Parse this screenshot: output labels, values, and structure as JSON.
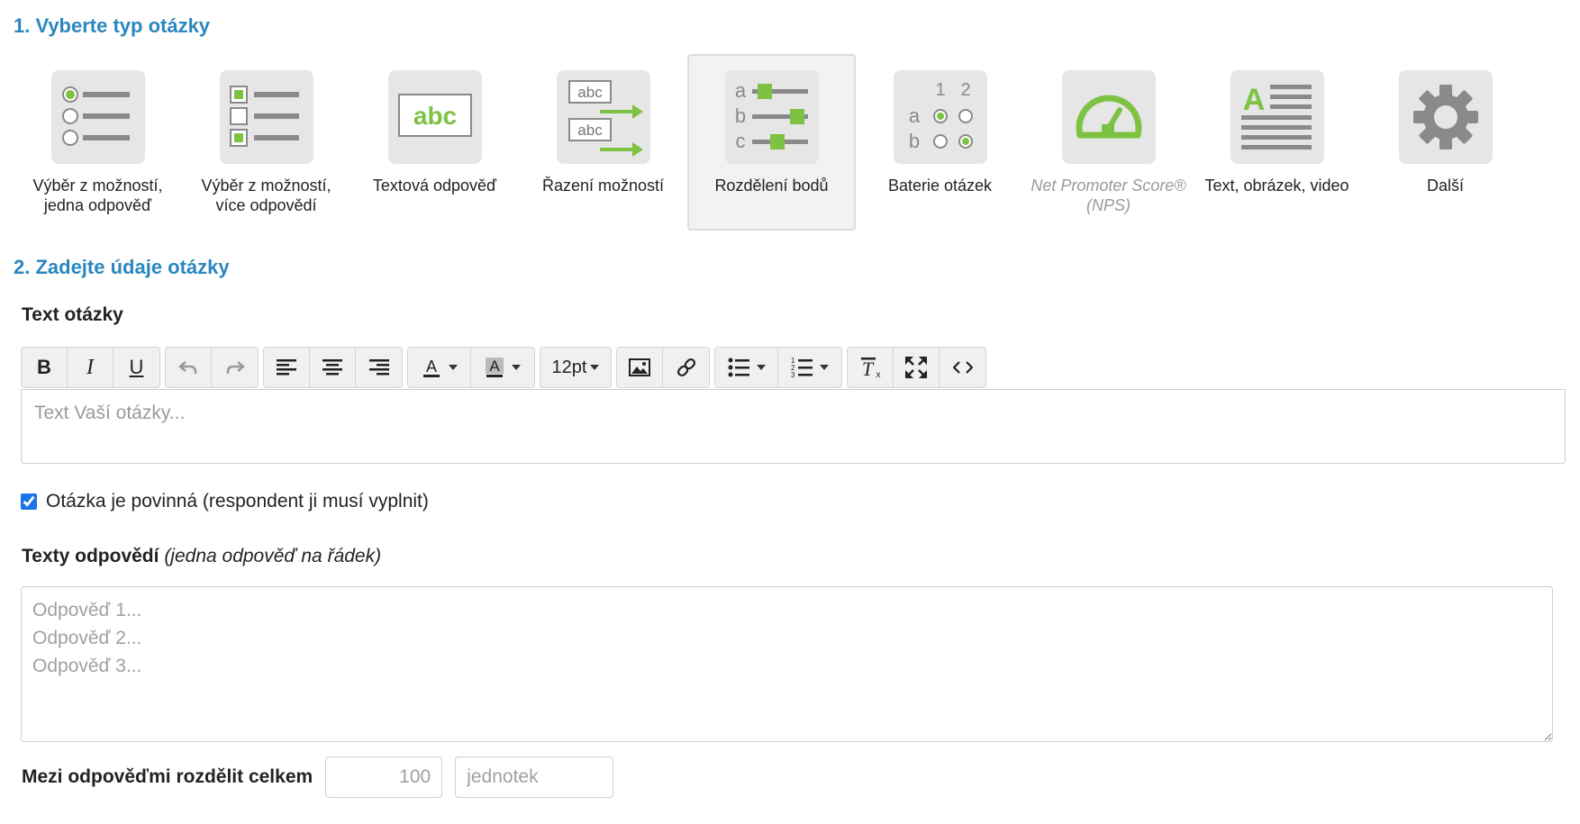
{
  "step1": {
    "title": "1. Vyberte typ otázky"
  },
  "question_types": [
    {
      "label": "Výběr z možností, jedna odpověď",
      "icon": "single-choice-icon",
      "selected": false,
      "disabled": false
    },
    {
      "label": "Výběr z možností, více odpovědí",
      "icon": "multiple-choice-icon",
      "selected": false,
      "disabled": false
    },
    {
      "label": "Textová odpověď",
      "icon": "text-answer-icon",
      "selected": false,
      "disabled": false
    },
    {
      "label": "Řazení možností",
      "icon": "ranking-icon",
      "selected": false,
      "disabled": false
    },
    {
      "label": "Rozdělení bodů",
      "icon": "point-distribution-icon",
      "selected": true,
      "disabled": false
    },
    {
      "label": "Baterie otázek",
      "icon": "question-matrix-icon",
      "selected": false,
      "disabled": false
    },
    {
      "label": "Net Promoter Score® (NPS)",
      "icon": "gauge-icon",
      "selected": false,
      "disabled": true
    },
    {
      "label": "Text, obrázek, video",
      "icon": "text-image-video-icon",
      "selected": false,
      "disabled": false
    },
    {
      "label": "Další",
      "icon": "gear-icon",
      "selected": false,
      "disabled": false
    }
  ],
  "icon_text": {
    "abc": "abc",
    "a": "a",
    "b": "b",
    "c": "c",
    "one": "1",
    "two": "2",
    "A": "A"
  },
  "step2": {
    "title": "2. Zadejte údaje otázky"
  },
  "question_text": {
    "label": "Text otázky",
    "placeholder": "Text Vaší otázky...",
    "font_size": "12pt"
  },
  "toolbar_icons": [
    "bold-icon",
    "italic-icon",
    "underline-icon",
    "undo-icon",
    "redo-icon",
    "align-left-icon",
    "align-center-icon",
    "align-right-icon",
    "text-color-icon",
    "background-color-icon",
    "image-icon",
    "link-icon",
    "bullet-list-icon",
    "numbered-list-icon",
    "clear-format-icon",
    "fullscreen-icon",
    "code-icon"
  ],
  "required": {
    "label": "Otázka je povinná (respondent ji musí vyplnit)",
    "checked": true
  },
  "answers": {
    "label": "Texty odpovědí",
    "hint": "(jedna odpověď na řádek)",
    "placeholder": "Odpověď 1...\nOdpověď 2...\nOdpověď 3..."
  },
  "total": {
    "label": "Mezi odpověďmi rozdělit celkem",
    "value_placeholder": "100",
    "unit_placeholder": "jednotek"
  },
  "colors": {
    "accent": "#2a87bf",
    "green": "#7dc242",
    "tile": "#e6e6e6",
    "icon_gray": "#8a8a8a"
  }
}
